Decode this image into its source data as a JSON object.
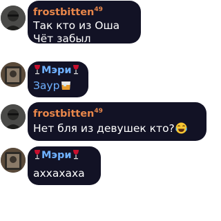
{
  "messages": [
    {
      "sender": "frostbitten",
      "sender_sup": "49",
      "sender_color": "#e8864a",
      "lines": [
        "Так кто из Оша",
        "Чёт забыл"
      ]
    },
    {
      "sender": "Мэри",
      "sender_color": "#6fb1ff",
      "sender_decor_icon": "wine-glass-icon",
      "lines": [
        "Заур"
      ],
      "line_emoji": "whisky-glass-icon"
    },
    {
      "sender": "frostbitten",
      "sender_sup": "49",
      "sender_color": "#e8864a",
      "lines": [
        "Нет бля из девушек кто?"
      ],
      "line_emoji": "laughing-face-icon"
    },
    {
      "sender": "Мэри",
      "sender_color": "#6fb1ff",
      "sender_decor_icon": "wine-glass-icon",
      "lines": [
        "аххахаха"
      ]
    }
  ],
  "colors": {
    "bubble_bg": "#121225",
    "text": "#ffffff",
    "page_bg": "#ffffff"
  }
}
